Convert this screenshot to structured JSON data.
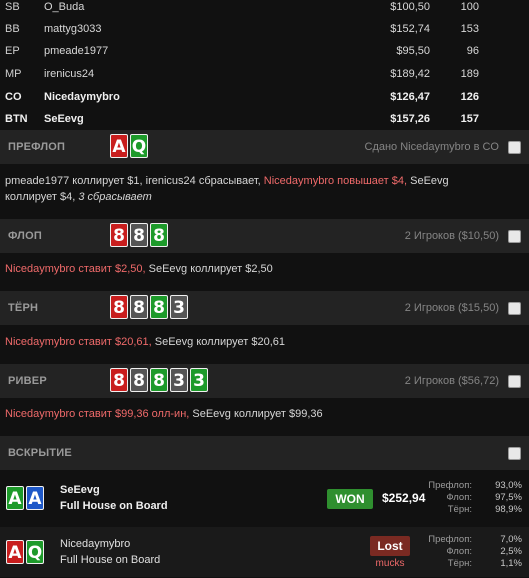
{
  "players": [
    {
      "pos": "SB",
      "name": "O_Buda",
      "stack": "$100,50",
      "bb": "100",
      "bold": false
    },
    {
      "pos": "BB",
      "name": "mattyg3033",
      "stack": "$152,74",
      "bb": "153",
      "bold": false
    },
    {
      "pos": "EP",
      "name": "pmeade1977",
      "stack": "$95,50",
      "bb": "96",
      "bold": false
    },
    {
      "pos": "MP",
      "name": "irenicus24",
      "stack": "$189,42",
      "bb": "189",
      "bold": false
    },
    {
      "pos": "CO",
      "name": "Nicedaymybro",
      "stack": "$126,47",
      "bb": "126",
      "bold": true
    },
    {
      "pos": "BTN",
      "name": "SeEevg",
      "stack": "$157,26",
      "bb": "157",
      "bold": true
    }
  ],
  "preflop": {
    "label": "ПРЕФЛОП",
    "cards": [
      {
        "rank": "A",
        "color": "red"
      },
      {
        "rank": "Q",
        "color": "green"
      }
    ],
    "info": "Сдано Nicedaymybro в CO",
    "action_line1_a": "pmeade1977 коллирует $1, irenicus24 сбрасывает, ",
    "action_line1_hero": "Nicedaymybro повышает $4,",
    "action_line1_b": " SeEevg",
    "action_line2_a": "коллирует $4, ",
    "action_line2_italic": "3 сбрасывает"
  },
  "flop": {
    "label": "ФЛОП",
    "cards": [
      {
        "rank": "8",
        "color": "red"
      },
      {
        "rank": "8",
        "color": "gray"
      },
      {
        "rank": "8",
        "color": "green"
      }
    ],
    "info": "2 Игроков ($10,50)",
    "action_hero": "Nicedaymybro ставит $2,50,",
    "action_rest": " SeEevg коллирует $2,50"
  },
  "turn": {
    "label": "ТЁРН",
    "cards": [
      {
        "rank": "8",
        "color": "red"
      },
      {
        "rank": "8",
        "color": "gray"
      },
      {
        "rank": "8",
        "color": "green"
      },
      {
        "rank": "3",
        "color": "gray"
      }
    ],
    "info": "2 Игроков ($15,50)",
    "action_hero": "Nicedaymybro ставит $20,61,",
    "action_rest": " SeEevg коллирует $20,61"
  },
  "river": {
    "label": "РИВЕР",
    "cards": [
      {
        "rank": "8",
        "color": "red"
      },
      {
        "rank": "8",
        "color": "gray"
      },
      {
        "rank": "8",
        "color": "green"
      },
      {
        "rank": "3",
        "color": "gray"
      },
      {
        "rank": "3",
        "color": "green"
      }
    ],
    "info": "2 Игроков ($56,72)",
    "action_hero": "Nicedaymybro ставит $99,36 олл-ин,",
    "action_rest": " SeEevg коллирует $99,36"
  },
  "showdown": {
    "label": "ВСКРЫТИЕ",
    "winner": {
      "cards": [
        {
          "rank": "A",
          "color": "green"
        },
        {
          "rank": "A",
          "color": "blue"
        }
      ],
      "name": "SeEevg",
      "hand": "Full House on Board",
      "badge": "WON",
      "amount": "$252,94",
      "equity": [
        {
          "label": "Префлоп:",
          "value": "93,0%"
        },
        {
          "label": "Флоп:",
          "value": "97,5%"
        },
        {
          "label": "Тёрн:",
          "value": "98,9%"
        }
      ]
    },
    "loser": {
      "cards": [
        {
          "rank": "A",
          "color": "red"
        },
        {
          "rank": "Q",
          "color": "green"
        }
      ],
      "name": "Nicedaymybro",
      "hand": "Full House on Board",
      "badge": "Lost",
      "sub": "mucks",
      "equity": [
        {
          "label": "Префлоп:",
          "value": "7,0%"
        },
        {
          "label": "Флоп:",
          "value": "2,5%"
        },
        {
          "label": "Тёрн:",
          "value": "1,1%"
        }
      ]
    }
  }
}
